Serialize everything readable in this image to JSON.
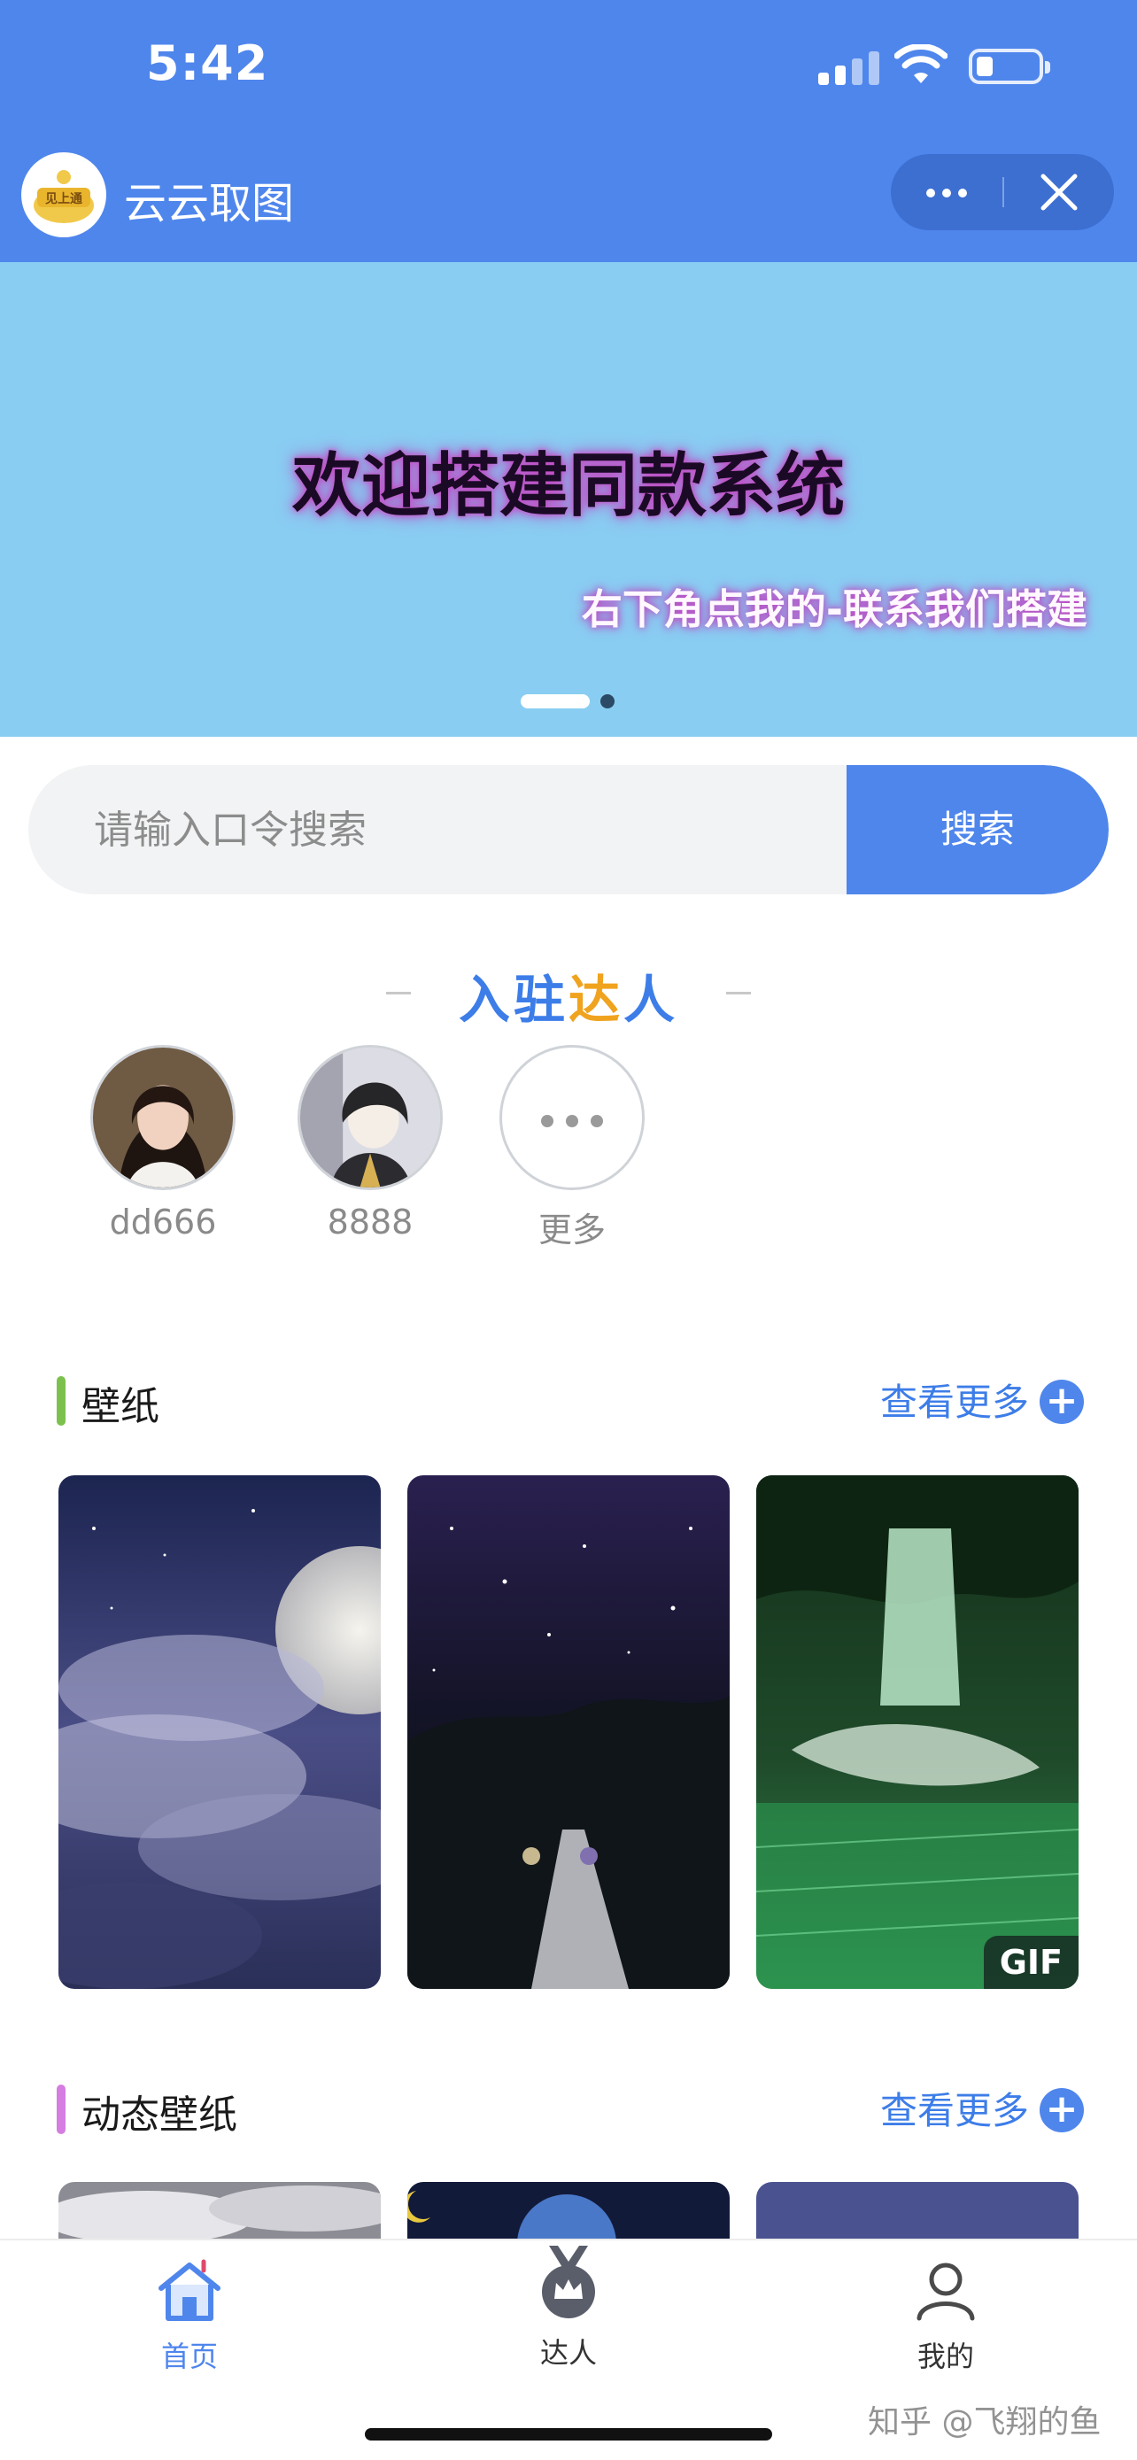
{
  "status_bar": {
    "time": "5:42"
  },
  "nav": {
    "title": "云云取图",
    "logo_text": "见上通"
  },
  "banner": {
    "headline": "欢迎搭建同款系统",
    "subline": "右下角点我的-联系我们搭建",
    "slides": 2,
    "active_slide": 1
  },
  "search": {
    "placeholder": "请输入口令搜索",
    "button_label": "搜索"
  },
  "experts_section": {
    "title_a": "入驻",
    "title_b": "达",
    "title_c": "人",
    "items": [
      {
        "name": "dd666"
      },
      {
        "name": "8888"
      },
      {
        "name": "更多"
      }
    ]
  },
  "categories": [
    {
      "label": "壁纸",
      "more_label": "查看更多",
      "accent": "#7cc14d",
      "thumbs": [
        "moon-clouds",
        "starry-stairs",
        "waterfall-gif"
      ],
      "badge": "GIF"
    },
    {
      "label": "动态壁纸",
      "more_label": "查看更多",
      "accent": "#d57de0",
      "thumbs": [
        "clouds",
        "blue-moon",
        "dusk"
      ]
    }
  ],
  "tabbar": {
    "items": [
      {
        "label": "首页",
        "icon": "home-icon",
        "active": true
      },
      {
        "label": "达人",
        "icon": "crown-medal-icon",
        "active": false
      },
      {
        "label": "我的",
        "icon": "user-icon",
        "active": false
      }
    ]
  },
  "watermark": "知乎 @飞翔的鱼"
}
